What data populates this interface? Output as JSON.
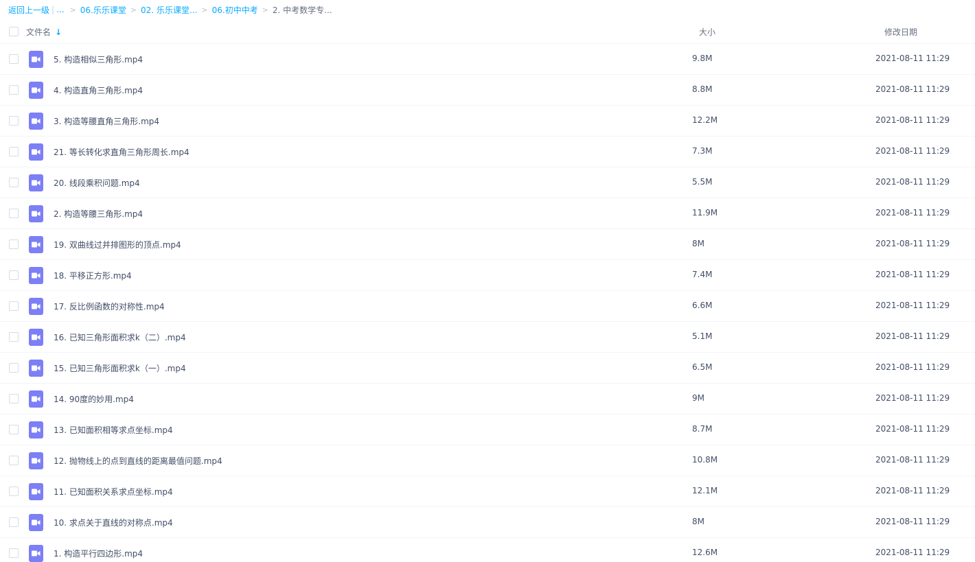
{
  "breadcrumb": {
    "back_label": "返回上一级",
    "separator": "|",
    "ellipsis": "...",
    "chevron": ">",
    "crumbs": [
      "06.乐乐课堂",
      "02. 乐乐课堂...",
      "06.初中中考"
    ],
    "current": "2. 中考数学专..."
  },
  "header": {
    "name_label": "文件名",
    "size_label": "大小",
    "date_label": "修改日期"
  },
  "colors": {
    "accent": "#09aaff",
    "video_icon": "#7c7ff5"
  },
  "files": [
    {
      "name": "5. 构造相似三角形.mp4",
      "size": "9.8M",
      "date": "2021-08-11 11:29",
      "icon": "video-file-icon"
    },
    {
      "name": "4. 构造直角三角形.mp4",
      "size": "8.8M",
      "date": "2021-08-11 11:29",
      "icon": "video-file-icon"
    },
    {
      "name": "3. 构造等腰直角三角形.mp4",
      "size": "12.2M",
      "date": "2021-08-11 11:29",
      "icon": "video-file-icon"
    },
    {
      "name": "21. 等长转化求直角三角形周长.mp4",
      "size": "7.3M",
      "date": "2021-08-11 11:29",
      "icon": "video-file-icon"
    },
    {
      "name": "20. 线段乘积问题.mp4",
      "size": "5.5M",
      "date": "2021-08-11 11:29",
      "icon": "video-file-icon"
    },
    {
      "name": "2. 构造等腰三角形.mp4",
      "size": "11.9M",
      "date": "2021-08-11 11:29",
      "icon": "video-file-icon"
    },
    {
      "name": "19. 双曲线过并排图形的顶点.mp4",
      "size": "8M",
      "date": "2021-08-11 11:29",
      "icon": "video-file-icon"
    },
    {
      "name": "18. 平移正方形.mp4",
      "size": "7.4M",
      "date": "2021-08-11 11:29",
      "icon": "video-file-icon"
    },
    {
      "name": "17. 反比例函数的对称性.mp4",
      "size": "6.6M",
      "date": "2021-08-11 11:29",
      "icon": "video-file-icon"
    },
    {
      "name": "16. 已知三角形面积求k（二）.mp4",
      "size": "5.1M",
      "date": "2021-08-11 11:29",
      "icon": "video-file-icon"
    },
    {
      "name": "15. 已知三角形面积求k（一）.mp4",
      "size": "6.5M",
      "date": "2021-08-11 11:29",
      "icon": "video-file-icon"
    },
    {
      "name": "14. 90度的妙用.mp4",
      "size": "9M",
      "date": "2021-08-11 11:29",
      "icon": "video-file-icon"
    },
    {
      "name": "13. 已知面积相等求点坐标.mp4",
      "size": "8.7M",
      "date": "2021-08-11 11:29",
      "icon": "video-file-icon"
    },
    {
      "name": "12. 抛物线上的点到直线的距离最值问题.mp4",
      "size": "10.8M",
      "date": "2021-08-11 11:29",
      "icon": "video-file-icon"
    },
    {
      "name": "11. 已知面积关系求点坐标.mp4",
      "size": "12.1M",
      "date": "2021-08-11 11:29",
      "icon": "video-file-icon"
    },
    {
      "name": "10. 求点关于直线的对称点.mp4",
      "size": "8M",
      "date": "2021-08-11 11:29",
      "icon": "video-file-icon"
    },
    {
      "name": "1. 构造平行四边形.mp4",
      "size": "12.6M",
      "date": "2021-08-11 11:29",
      "icon": "video-file-icon"
    }
  ]
}
